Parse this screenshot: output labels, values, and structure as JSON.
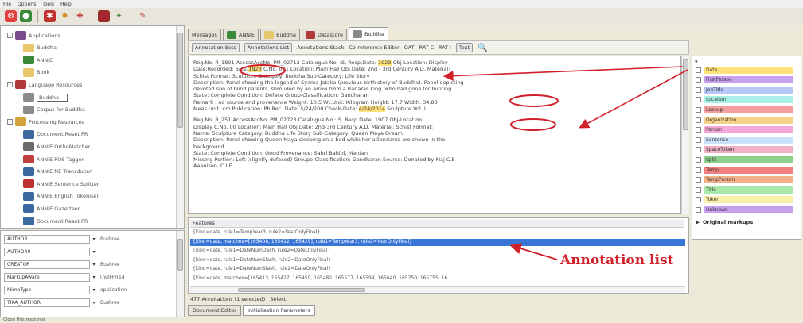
{
  "menu": [
    "File",
    "Options",
    "Tools",
    "Help"
  ],
  "resource_tree": [
    {
      "label": "Applications",
      "level": 0,
      "expander": "-",
      "color": "#7a4b8c"
    },
    {
      "label": "Buddha",
      "level": 1,
      "color": "#e6c76a"
    },
    {
      "label": "ANNIE",
      "level": 1,
      "color": "#3a8a3a"
    },
    {
      "label": "Book",
      "level": 1,
      "color": "#e6c76a"
    },
    {
      "label": "Language Resources",
      "level": 0,
      "expander": "-",
      "color": "#b03a3a"
    },
    {
      "label": "Buddha",
      "level": 1,
      "color": "#8a8a8a",
      "selected": true
    },
    {
      "label": "Corpus for Buddha",
      "level": 1,
      "color": "#8a8a8a"
    },
    {
      "label": "Processing Resources",
      "level": 0,
      "expander": "-",
      "color": "#d4a43a"
    },
    {
      "label": "Document Reset PR",
      "level": 1,
      "color": "#3a6aa0"
    },
    {
      "label": "ANNIE OrthoMatcher",
      "level": 1,
      "color": "#6a6a6a"
    },
    {
      "label": "ANNIE POS Tagger",
      "level": 1,
      "color": "#c04040"
    },
    {
      "label": "ANNIE NE Transducer",
      "level": 1,
      "color": "#3a6aa0"
    },
    {
      "label": "ANNIE Sentence Splitter",
      "level": 1,
      "color": "#c03030"
    },
    {
      "label": "ANNIE English Tokeniser",
      "level": 1,
      "color": "#3a6aa0"
    },
    {
      "label": "ANNIE Gazetteer",
      "level": 1,
      "color": "#3a6aa0"
    },
    {
      "label": "Document Reset PR",
      "level": 1,
      "color": "#3a6aa0"
    }
  ],
  "metadata": [
    {
      "key": "AUTHOR",
      "value": "Bushree"
    },
    {
      "key": "AUTHOR0",
      "value": ""
    },
    {
      "key": "CREATOR",
      "value": "Bushree"
    },
    {
      "key": "MarkupAware",
      "value": "[null+][14"
    },
    {
      "key": "MimeType",
      "value": "application"
    },
    {
      "key": "TIKA_AUTHOR",
      "value": "Bushree"
    }
  ],
  "tabs": [
    {
      "label": "Messages",
      "color": ""
    },
    {
      "label": "ANNIE",
      "color": "#3a8a3a"
    },
    {
      "label": "Buddha",
      "color": "#e6c76a"
    },
    {
      "label": "Datastore",
      "color": "#b03a3a"
    },
    {
      "label": "Buddha",
      "color": "#8a8a8a",
      "active": true
    }
  ],
  "subtoolbar": {
    "buttons": [
      "Annotation Sets",
      "Annotations List"
    ],
    "items": [
      "Annotations Stack",
      "Co-reference Editor",
      "OAT",
      "RAT-C",
      "RAT-I"
    ],
    "text_button": "Text"
  },
  "document_paragraphs": [
    "Reg.No. R_1891  AccessAccNo. PM_02712  Catalogue No. :S,  Recp.Date: 1923 Obj-Location: Display",
    "Date:Recorded: 6/22/1923  C.No. 001  Location: Main Hall Obj.Date: 2nd - 3rd Century A.D.  Material:",
    "Schist  Format:  Sculpture Category: Buddha  Sub-Category: Life Story",
    "Description: Panel showing the legend of Syama Jataka (previous birth story of Buddha). Panel depicting",
    "devoted son of blind parents, shrouded by an arrow from a Banaras king, who had gone for hunting.",
    "State: Complete  Condition: Deface  Group-Classification: Gandharan",
    "Remark : no source and provenance  Weight: 10.5  Wt.Unit: Kilogram  Height: 17.7  Width: 34.83",
    "Meas.Unit: cm  Publication: Pb  Rec. Date: 5/24/200  Check-Date: 4/24/2014  Sculpture Vol. I",
    "",
    "Reg.No. R_251 AccessAccNo. PM_02723  Catalogue No.: S,  Recp.Date: 1907  Obj-Location",
    "Display  C.No. 00  Location: Main Hall Obj.Date: 2nd-3rd Century A.D.  Material: Schist  Format:",
    "Name: Sculpture Category: Buddha Life Story  Sub-Category: Queen Maya Dream",
    "Description: Panel showing Queen Maya sleeping on a bed while her attendants are shown in the",
    "background.",
    "State: Complete  Condition: Good  Provenance: Sahri Bahlol, Mardan",
    "Missing Portion: Left (slightly defaced)  Groupe-Classification: Gandharan Source: Donated by Maj C.E",
    "Aaanison, C.I.E."
  ],
  "highlights": {
    "first_date": "6/22/1923",
    "check_date": "4/24/2014",
    "recp_date": "Recp.Date: 1907",
    "recp_year": "1923"
  },
  "features": {
    "header": "Features",
    "rows": [
      "{kind=date, rule1=TempYear3, rule2=YearOnlyFinal}",
      "{kind=date, matches=[165408, 165412, 165429], rule1=TempYear3, rule2=YearOnlyFinal}",
      "{kind=date, rule1=DateNumDash, rule2=DateOnlyFinal}",
      "{kind=date, rule1=DateNumSlash, rule2=DateOnlyFinal}",
      "{kind=date, rule1=DateNumSlash, rule2=DateOnlyFinal}",
      "{kind=date, matches=[165413, 165427, 165459, 165482, 165577, 165599, 165640, 165750, 165755, 16"
    ]
  },
  "status": {
    "annotations": "477 Annotations (1 selected)",
    "select": "Select:"
  },
  "bottom_tabs": [
    {
      "label": "Document Editor"
    },
    {
      "label": "Initialisation Parameters",
      "active": true
    }
  ],
  "annotation_types": [
    {
      "label": "Date",
      "color": "#ffe27a"
    },
    {
      "label": "FirstPerson",
      "color": "#c8a0f0"
    },
    {
      "label": "JobTitle",
      "color": "#b8c8f8"
    },
    {
      "label": "Location",
      "color": "#a8f0e8"
    },
    {
      "label": "Lookup",
      "color": "#f4a0a0"
    },
    {
      "label": "Organization",
      "color": "#f6d28a"
    },
    {
      "label": "Person",
      "color": "#f4a8d8"
    },
    {
      "label": "Sentence",
      "color": "#c8e0f8"
    },
    {
      "label": "SpaceToken",
      "color": "#f0b0c8"
    },
    {
      "label": "Split",
      "color": "#8cd08c"
    },
    {
      "label": "Temp",
      "color": "#f08080"
    },
    {
      "label": "TempPerson",
      "color": "#f4b088"
    },
    {
      "label": "Title",
      "color": "#a8e8a8"
    },
    {
      "label": "Token",
      "color": "#f8f0a8"
    },
    {
      "label": "Unknown",
      "color": "#c8a0f0"
    }
  ],
  "original_markups": "Original markups",
  "overlay_label": "Annotation list",
  "accent_red": "#d1202a",
  "status_bar": "Close this resource"
}
